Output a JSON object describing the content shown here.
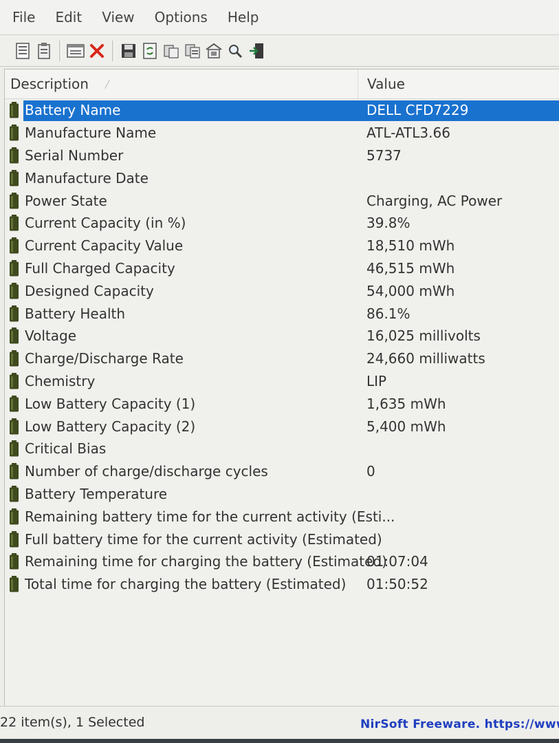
{
  "menu": {
    "items": [
      "File",
      "Edit",
      "View",
      "Options",
      "Help"
    ]
  },
  "toolbar": {
    "icons": [
      "html-report-icon",
      "selected-report-icon",
      "properties-icon",
      "delete-icon",
      "save-icon",
      "refresh-icon",
      "copy-icon",
      "copy-all-icon",
      "advanced-options-icon",
      "find-icon",
      "exit-icon"
    ]
  },
  "list": {
    "columns": {
      "description": "Description",
      "value": "Value"
    },
    "rows": [
      {
        "description": "Battery Name",
        "value": "DELL CFD7229",
        "selected": true
      },
      {
        "description": "Manufacture Name",
        "value": "ATL-ATL3.66"
      },
      {
        "description": "Serial Number",
        "value": "5737"
      },
      {
        "description": "Manufacture Date",
        "value": ""
      },
      {
        "description": "Power State",
        "value": "Charging, AC Power"
      },
      {
        "description": "Current Capacity (in %)",
        "value": "39.8%"
      },
      {
        "description": "Current Capacity Value",
        "value": "18,510 mWh"
      },
      {
        "description": "Full Charged Capacity",
        "value": "46,515 mWh"
      },
      {
        "description": "Designed Capacity",
        "value": "54,000 mWh"
      },
      {
        "description": "Battery Health",
        "value": "86.1%"
      },
      {
        "description": "Voltage",
        "value": "16,025 millivolts"
      },
      {
        "description": "Charge/Discharge Rate",
        "value": "24,660 milliwatts"
      },
      {
        "description": "Chemistry",
        "value": "LIP"
      },
      {
        "description": "Low Battery Capacity (1)",
        "value": "1,635 mWh"
      },
      {
        "description": "Low Battery Capacity (2)",
        "value": "5,400 mWh"
      },
      {
        "description": "Critical Bias",
        "value": ""
      },
      {
        "description": "Number of charge/discharge cycles",
        "value": "0"
      },
      {
        "description": "Battery Temperature",
        "value": ""
      },
      {
        "description": "Remaining battery time for the current activity (Esti...",
        "value": ""
      },
      {
        "description": "Full battery time for the current activity (Estimated)",
        "value": ""
      },
      {
        "description": "Remaining time for charging the battery (Estimated)",
        "value": "01:07:04"
      },
      {
        "description": "Total  time for charging the battery (Estimated)",
        "value": "01:50:52"
      }
    ]
  },
  "status": {
    "count": "22 item(s), 1 Selected",
    "link": "NirSoft Freeware. https://www"
  },
  "colors": {
    "selection": "#1a72cf",
    "battery_icon": "#3f4a1e",
    "link": "#1f3fbf"
  }
}
